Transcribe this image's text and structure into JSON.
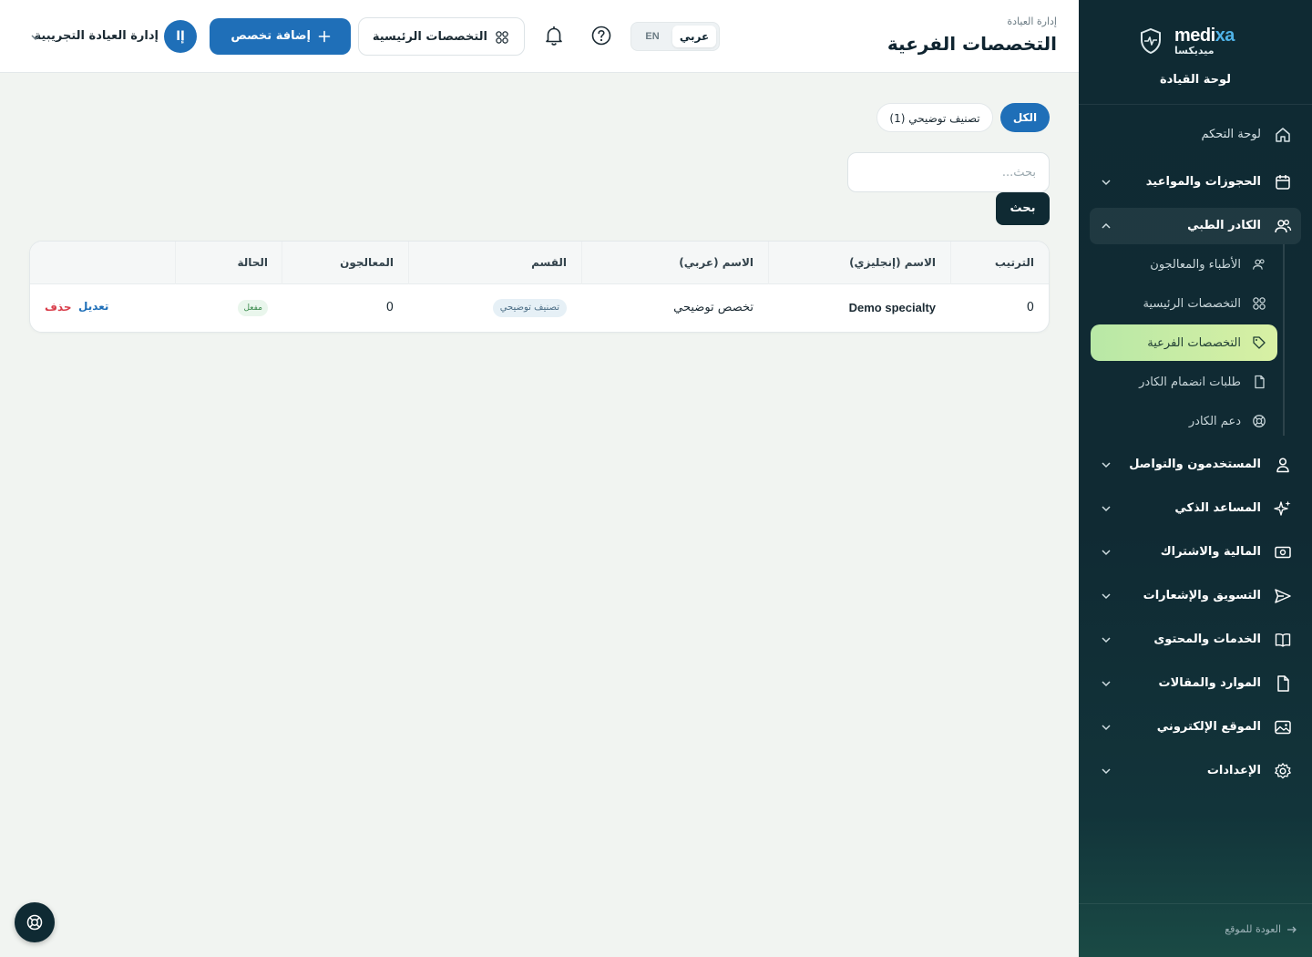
{
  "brand": {
    "name_en_prefix": "medi",
    "name_en_suffix": "xa",
    "name_ar": "ميديكسا"
  },
  "sidebar": {
    "title": "لوحة القيادة",
    "items": [
      {
        "label": "لوحة التحكم",
        "icon": "home-icon"
      },
      {
        "label": "الحجوزات والمواعيد",
        "icon": "calendar-icon"
      },
      {
        "label": "الكادر الطبي",
        "icon": "users-icon"
      },
      {
        "label": "المستخدمون والتواصل",
        "icon": "user-icon"
      },
      {
        "label": "المساعد الذكي",
        "icon": "sparkles-icon"
      },
      {
        "label": "المالية والاشتراك",
        "icon": "money-icon"
      },
      {
        "label": "التسويق والإشعارات",
        "icon": "send-icon"
      },
      {
        "label": "الخدمات والمحتوى",
        "icon": "book-icon"
      },
      {
        "label": "الموارد والمقالات",
        "icon": "file-icon"
      },
      {
        "label": "الموقع الإلكتروني",
        "icon": "image-icon"
      },
      {
        "label": "الإعدادات",
        "icon": "gear-icon"
      }
    ],
    "sub_items": [
      {
        "label": "الأطباء والمعالجون",
        "icon": "users-icon"
      },
      {
        "label": "التخصصات الرئيسية",
        "icon": "grid-icon"
      },
      {
        "label": "التخصصات الفرعية",
        "icon": "tag-icon"
      },
      {
        "label": "طلبات انضمام الكادر",
        "icon": "file-icon"
      },
      {
        "label": "دعم الكادر",
        "icon": "lifebuoy-icon"
      }
    ],
    "back_link": "العودة للموقع"
  },
  "header": {
    "breadcrumb": "إدارة العيادة",
    "title": "التخصصات الفرعية",
    "lang_ar": "عربي",
    "lang_en": "EN",
    "main_specialties_button": "التخصصات الرئيسية",
    "add_button": "إضافة تخصص",
    "avatar_initials": "إا",
    "clinic_name": "إدارة العيادة التجريبية"
  },
  "filters": {
    "all": "الكل",
    "demo": "تصنيف توضيحي (1)"
  },
  "search": {
    "placeholder": "بحث...",
    "button": "بحث"
  },
  "table": {
    "columns": [
      "الترتيب",
      "الاسم (إنجليزي)",
      "الاسم (عربي)",
      "القسم",
      "المعالجون",
      "الحالة"
    ],
    "rows": [
      {
        "order": "0",
        "name_en": "Demo specialty",
        "name_ar": "تخصص توضيحي",
        "category": "تصنيف توضيحي",
        "practitioners": "0",
        "status": "مفعل",
        "edit": "تعديل",
        "delete": "حذف"
      }
    ]
  },
  "colors": {
    "accent": "#1f6fb8",
    "sidebar_bg": "#0f2a33",
    "active_item": "#c8ecaa",
    "danger": "#d93d4a"
  }
}
